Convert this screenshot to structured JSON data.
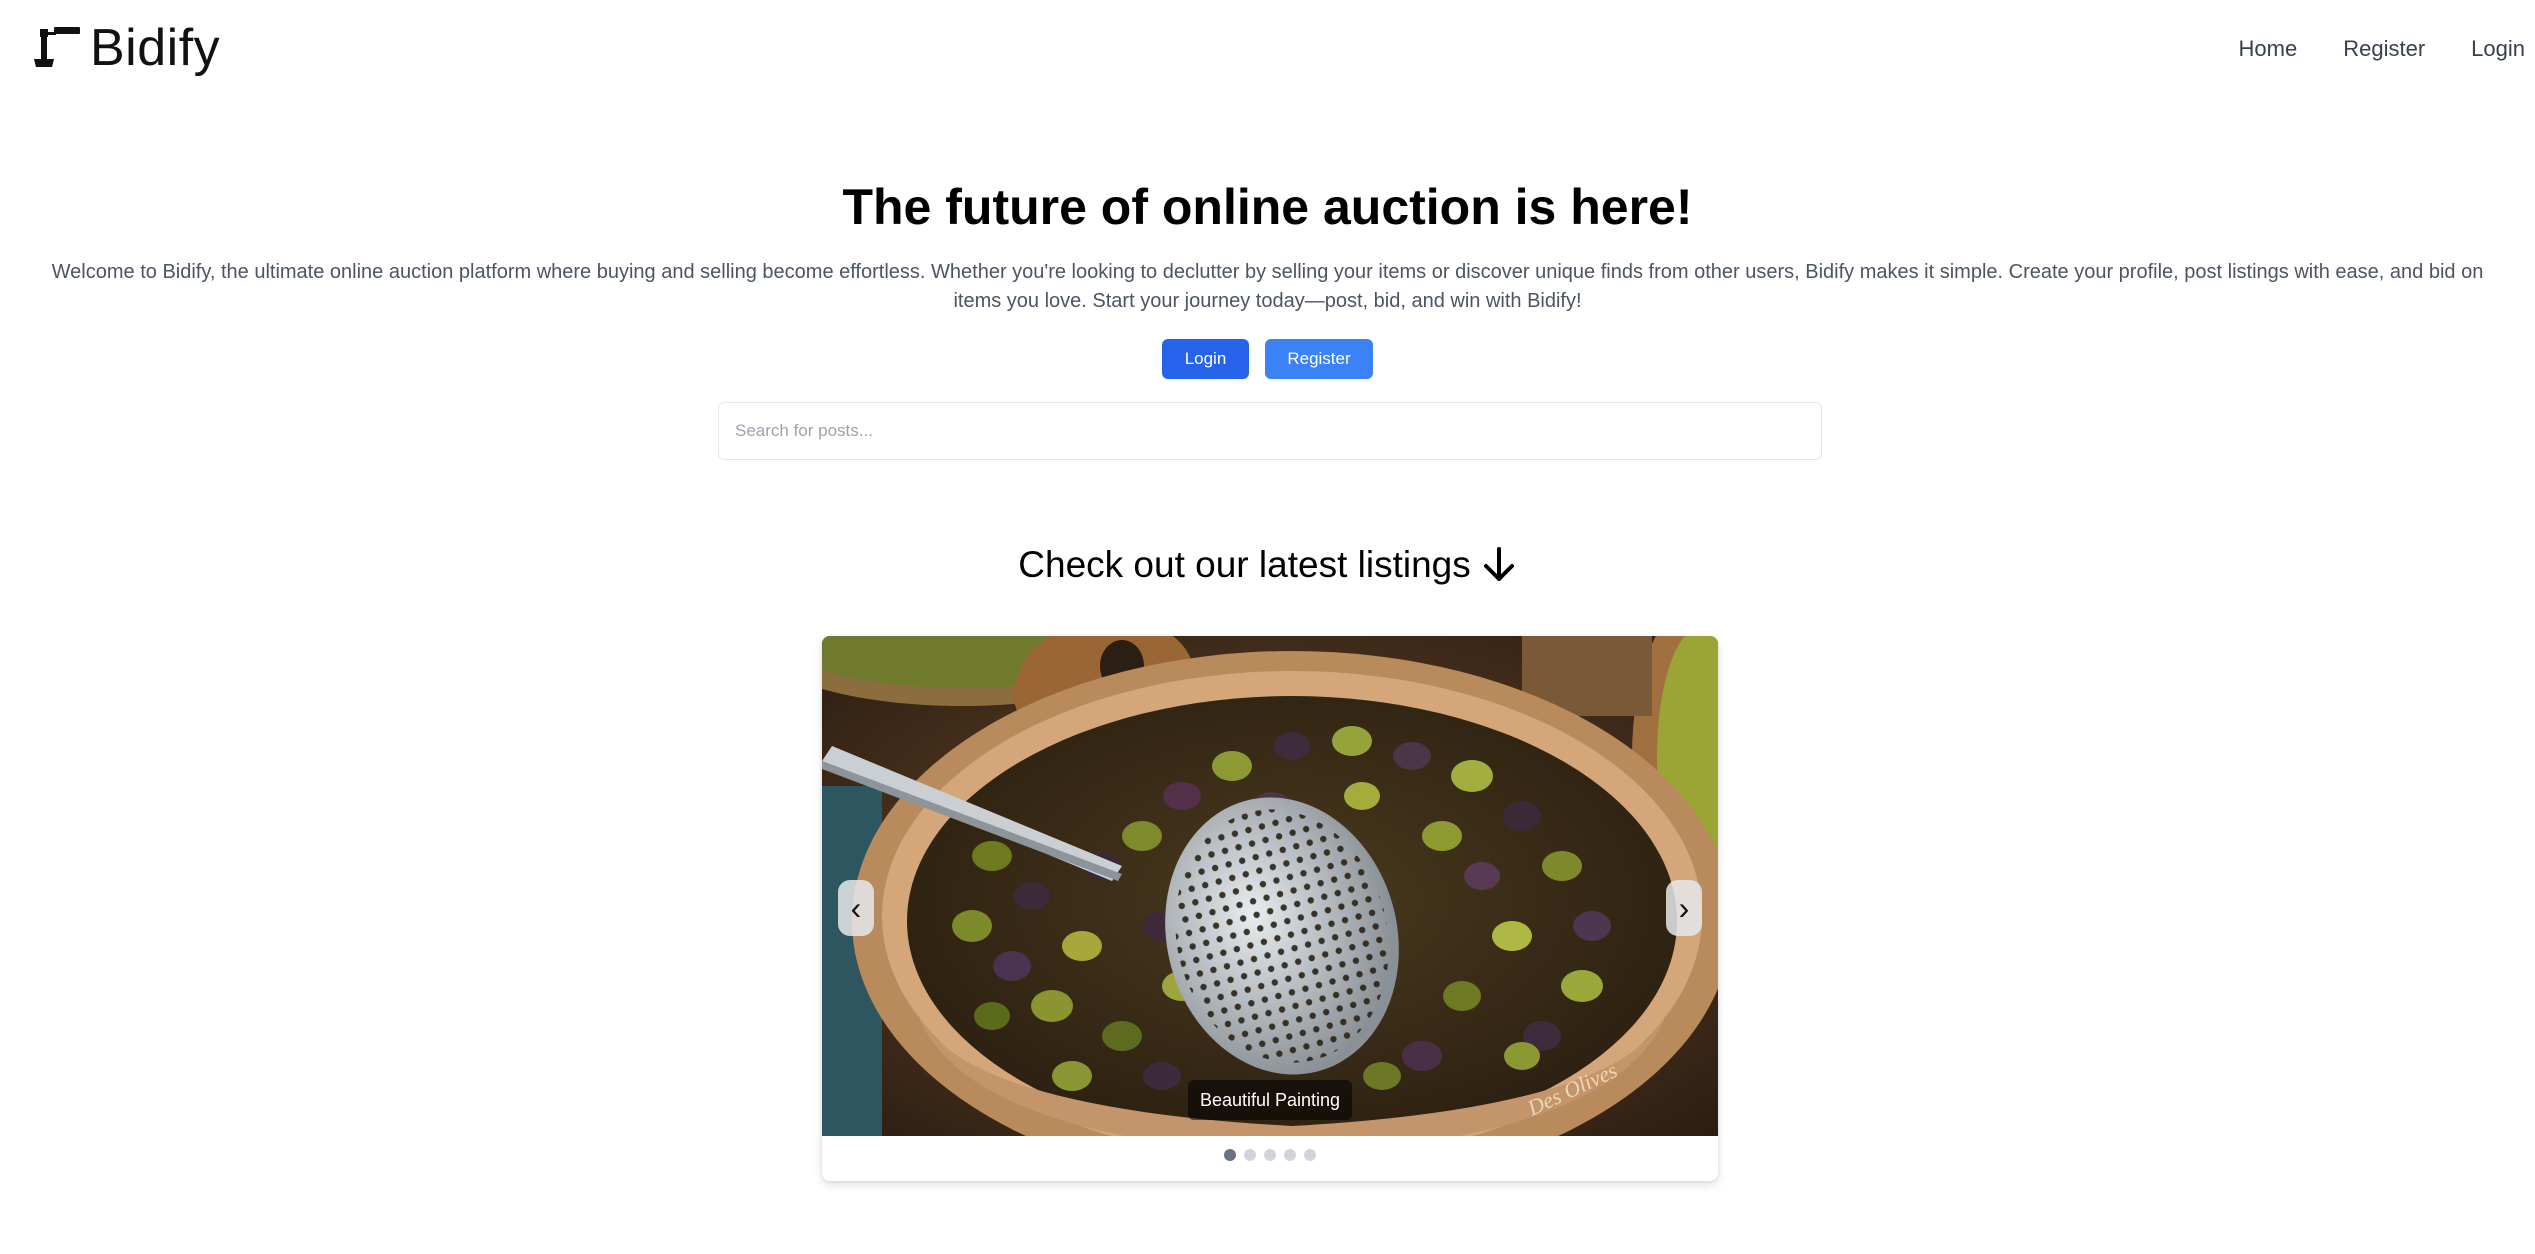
{
  "brand": {
    "name": "Bidify",
    "icon": "gavel-icon"
  },
  "nav": {
    "home": "Home",
    "register": "Register",
    "login": "Login"
  },
  "hero": {
    "title": "The future of online auction is here!",
    "description": "Welcome to Bidify, the ultimate online auction platform where buying and selling become effortless. Whether you're looking to declutter by selling your items or discover unique finds from other users, Bidify makes it simple. Create your profile, post listings with ease, and bid on items you love. Start your journey today—post, bid, and win with Bidify!",
    "login_button": "Login",
    "register_button": "Register",
    "login_color": "#2563eb",
    "register_color": "#3b82f6"
  },
  "search": {
    "placeholder": "Search for posts..."
  },
  "listings": {
    "title": "Check out our latest listings",
    "arrow_icon": "arrow-down-icon",
    "carousel": {
      "caption": "Beautiful Painting",
      "prev_icon": "chevron-left-icon",
      "next_icon": "chevron-right-icon",
      "prev_glyph": "‹",
      "next_glyph": "›",
      "slide_count": 5,
      "active_slide": 1
    }
  }
}
